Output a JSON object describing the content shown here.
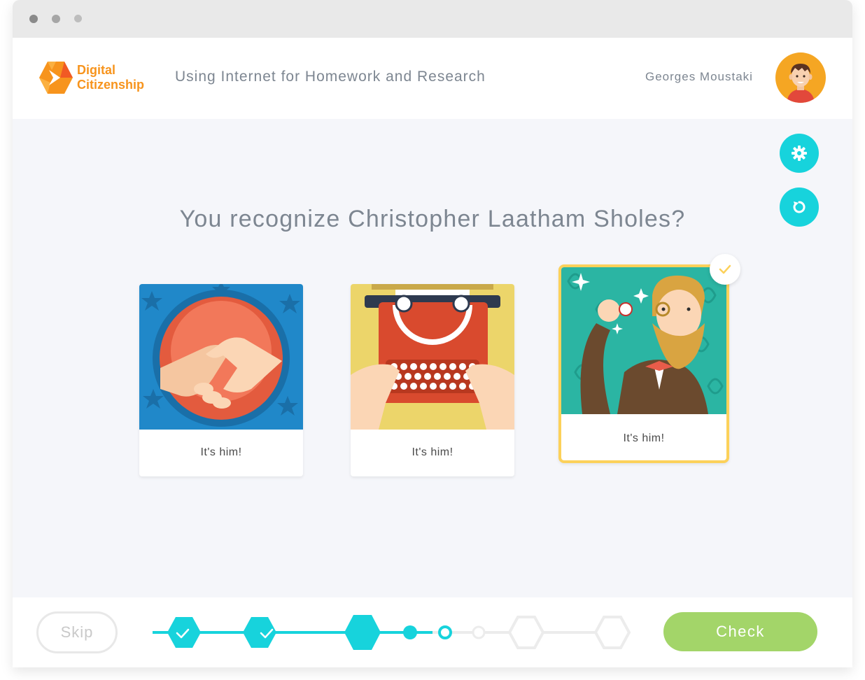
{
  "app": {
    "brand_line1": "Digital",
    "brand_line2": "Citizenship",
    "lesson_title": "Using Internet for Homework and Research",
    "user_name": "Georges Moustaki"
  },
  "question": "You recognize Christopher Laatham Sholes?",
  "cards": [
    {
      "label": "It's him!",
      "illustration": "handshake",
      "selected": false
    },
    {
      "label": "It's him!",
      "illustration": "typewriter",
      "selected": false
    },
    {
      "label": "It's him!",
      "illustration": "bearded-man-with-monocle",
      "selected": true
    }
  ],
  "footer": {
    "skip_label": "Skip",
    "check_label": "Check",
    "progress_steps": [
      "completed",
      "completed",
      "current",
      "dot-filled",
      "dot-current",
      "dot-empty",
      "pending",
      "pending"
    ]
  },
  "icons": {
    "settings": "gear-icon",
    "reset": "refresh-icon",
    "selected": "checkmark-icon"
  },
  "colors": {
    "accent": "#17d3dc",
    "brand": "#f7941d",
    "check_button": "#a3d569",
    "selected_border": "#fcd15a",
    "text": "#7d8691"
  }
}
